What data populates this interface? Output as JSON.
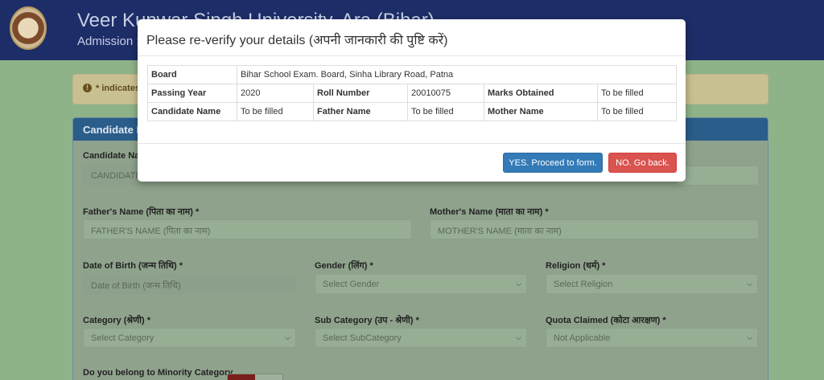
{
  "header": {
    "title": "Veer Kunwar Singh University, Ara (Bihar)",
    "subtitle": "Admission :"
  },
  "alert": {
    "icon": "info-icon",
    "text": "* indicates"
  },
  "panel": {
    "title": "Candidate F"
  },
  "form": {
    "candidate_name_label": "Candidate Na",
    "candidate_name_placeholder": "CANDIDATE",
    "father_label": "Father's Name (पिता का नाम) *",
    "father_placeholder": "FATHER'S NAME (पिता का नाम)",
    "mother_label": "Mother's Name (माता का नाम) *",
    "mother_placeholder": "MOTHER'S NAME (माता का नाम)",
    "dob_label": "Date of Birth (जन्म तिथि) *",
    "dob_placeholder": "Date of Birth (जन्म तिथि)",
    "gender_label": "Gender (लिंग) *",
    "gender_value": "Select Gender",
    "religion_label": "Religion (धर्म) *",
    "religion_value": "Select Religion",
    "category_label": "Category (श्रेणी) *",
    "category_value": "Select Category",
    "subcategory_label": "Sub Category (उप - श्रेणी) *",
    "subcategory_value": "Select SubCategory",
    "quota_label": "Quota Claimed (कोटा आरक्षण) *",
    "quota_value": "Not Applicable",
    "minority_label": "Do you belong to Minority Category"
  },
  "modal": {
    "title": "Please re-verify your details (अपनी जानकारी की पुष्टि करें)",
    "rows": {
      "board_key": "Board",
      "board_val": "Bihar School Exam. Board, Sinha Library Road, Patna",
      "year_key": "Passing Year",
      "year_val": "2020",
      "roll_key": "Roll Number",
      "roll_val": "20010075",
      "marks_key": "Marks Obtained",
      "marks_val": "To be filled",
      "cand_key": "Candidate Name",
      "cand_val": "To be filled",
      "father_key": "Father Name",
      "father_val": "To be filled",
      "mother_key": "Mother Name",
      "mother_val": "To be filled"
    },
    "yes_label": "YES. Proceed to form.",
    "no_label": "NO. Go back."
  },
  "colors": {
    "header_bg": "#1d2d67",
    "primary_button": "#337ab7",
    "danger_button": "#d9534f",
    "panel_header": "#2a5d8a"
  }
}
